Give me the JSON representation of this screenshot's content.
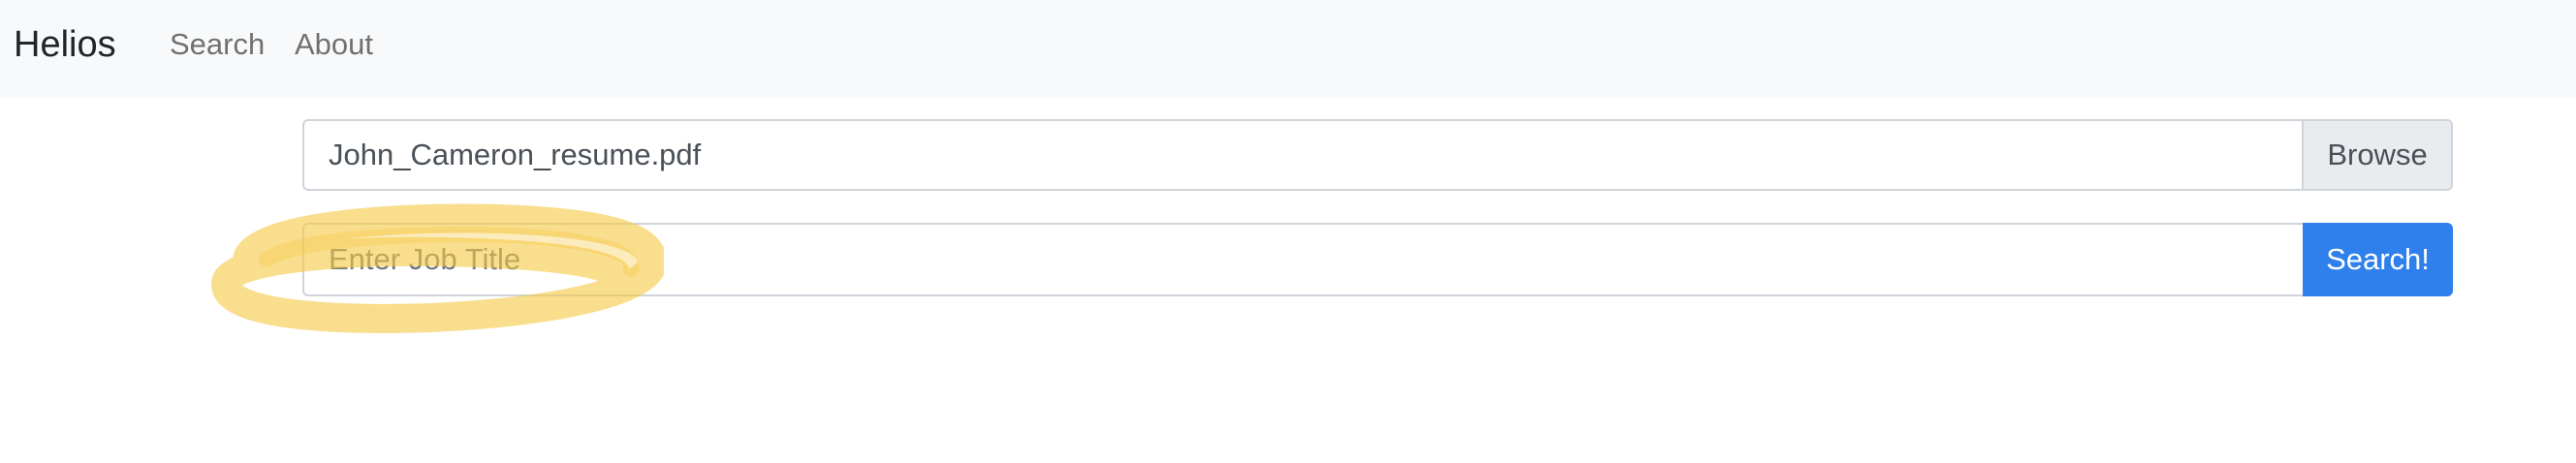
{
  "navbar": {
    "brand": "Helios",
    "links": [
      {
        "label": "Search"
      },
      {
        "label": "About"
      }
    ]
  },
  "upload": {
    "file_name": "John_Cameron_resume.pdf",
    "browse_label": "Browse"
  },
  "job_search": {
    "placeholder": "Enter Job Title",
    "value": "",
    "button_label": "Search!"
  },
  "colors": {
    "navbar_bg": "#f8f9fa",
    "primary": "#2f80ed",
    "highlight": "#f5c842"
  }
}
